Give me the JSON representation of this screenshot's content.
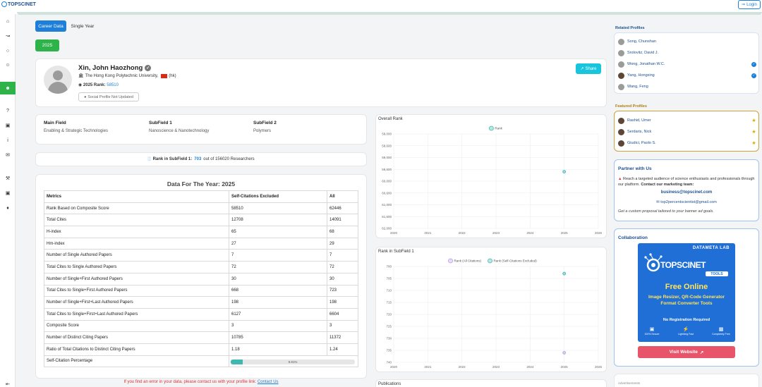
{
  "app": {
    "logo_text": "TOPSCINET",
    "login_label": "Login"
  },
  "sidebar": {
    "icons": [
      "home-icon",
      "chart-icon",
      "award-icon",
      "user-check-icon",
      "users-icon",
      "question-icon",
      "inbox-icon",
      "info-icon",
      "mail-icon",
      "wrench-icon",
      "briefcase-icon",
      "tags-icon",
      "collapse-icon"
    ]
  },
  "tabs": {
    "career": "Career Data",
    "single": "Single Year"
  },
  "year_button": "2025",
  "profile": {
    "name": "Xin, John Haozhong",
    "university": "The Hong Kong Polytechnic University,",
    "country_code": "(hk)",
    "rank_label": "2025 Rank:",
    "rank_value": "58510",
    "social_label": "Social Profile Not Updated",
    "share_label": "Share"
  },
  "fields": {
    "main_label": "Main Field",
    "main_value": "Enabling & Strategic Technologies",
    "sub1_label": "SubField 1",
    "sub1_value": "Nanoscience & Nanotechnology",
    "sub2_label": "SubField 2",
    "sub2_value": "Polymers"
  },
  "subfield_rank": {
    "prefix": "Rank in SubField 1:",
    "value": "703",
    "suffix": "out of 156020 Researchers"
  },
  "data_table": {
    "title": "Data For The Year: 2025",
    "headers": [
      "Metrics",
      "Self-Citations Excluded",
      "All"
    ],
    "rows": [
      [
        "Rank Based on Composite Score",
        "58510",
        "62446"
      ],
      [
        "Total Cites",
        "12708",
        "14091"
      ],
      [
        "H-index",
        "65",
        "68"
      ],
      [
        "Hm-index",
        "27",
        "29"
      ],
      [
        "Number of Single Authored Papers",
        "7",
        "7"
      ],
      [
        "Total Cites to Single Authored Papers",
        "72",
        "72"
      ],
      [
        "Number of Single+First Authored Papers",
        "30",
        "30"
      ],
      [
        "Total Cites to Single+First Authored Papers",
        "668",
        "723"
      ],
      [
        "Number of Single+First+Last Authored Papers",
        "198",
        "198"
      ],
      [
        "Total Cites to Single+First+Last Authored Papers",
        "6127",
        "6604"
      ],
      [
        "Composite Score",
        "3",
        "3"
      ],
      [
        "Number of Distinct Citing Papers",
        "10785",
        "11372"
      ],
      [
        "Ratio of Total Citations to Distinct Citing Papers",
        "1.18",
        "1.24"
      ]
    ],
    "self_citation_label": "Self-Citation Percentage",
    "self_citation_text": "9.81%",
    "self_citation_fraction": 0.0981
  },
  "error_notice": {
    "text": "If you find an error in your data, please contact us with your profile link:",
    "link": "Contact Us"
  },
  "chart_data": [
    {
      "type": "scatter",
      "title": "Overall Rank",
      "legend": [
        "Rank"
      ],
      "legend_placement": "top",
      "x_ticks": [
        "2020",
        "2021",
        "2022",
        "2023",
        "2024",
        "2025",
        "2026"
      ],
      "y_ticks": [
        "58,000",
        "58,600",
        "59,000",
        "59,600",
        "60,000",
        "60,600",
        "61,000",
        "61,600",
        "62,000"
      ],
      "xlim": [
        2020,
        2026
      ],
      "ylim": [
        58000,
        62000
      ],
      "y_inverted": true,
      "grid": true,
      "series": [
        {
          "name": "Rank",
          "color": "#3fb8b1",
          "points": [
            [
              2025,
              59600
            ]
          ]
        }
      ]
    },
    {
      "type": "scatter",
      "title": "Rank in SubField 1",
      "legend": [
        "Rank (All Citations)",
        "Rank (Self-Citations Excluded)"
      ],
      "legend_placement": "top",
      "x_ticks": [
        "2020",
        "2021",
        "2022",
        "2023",
        "2024",
        "2025",
        "2026"
      ],
      "y_ticks": [
        "700",
        "705",
        "710",
        "715",
        "720",
        "725",
        "730",
        "735",
        "740"
      ],
      "xlim": [
        2020,
        2026
      ],
      "ylim": [
        700,
        740
      ],
      "y_inverted": true,
      "grid": true,
      "series": [
        {
          "name": "Rank (All Citations)",
          "color": "#b69ce8",
          "points": [
            [
              2025,
              736
            ]
          ]
        },
        {
          "name": "Rank (Self-Citations Excluded)",
          "color": "#3fb8b1",
          "points": [
            [
              2025,
              703
            ]
          ]
        }
      ]
    }
  ],
  "publications_label": "Publications",
  "related": {
    "title": "Related Profiles",
    "items": [
      {
        "name": "Song, Chunshan",
        "verified": false,
        "photo": false
      },
      {
        "name": "Srolovitz, David J.",
        "verified": false,
        "photo": false
      },
      {
        "name": "Wong, Jonathan W.C.",
        "verified": true,
        "photo": false
      },
      {
        "name": "Yang, Hongxing",
        "verified": true,
        "photo": true
      },
      {
        "name": "Wang, Feng",
        "verified": false,
        "photo": false
      }
    ]
  },
  "featured": {
    "title": "Featured Profiles",
    "items": [
      {
        "name": "Rashid, Umer"
      },
      {
        "name": "Serdaris, Nick"
      },
      {
        "name": "Giudici, Paolo S."
      }
    ]
  },
  "partner": {
    "title": "Partner with Us",
    "text_lead": "Reach a targeted audience of science enthusiasts and professionals through our platform.",
    "text_bold": "Contact our marketing team:",
    "email_primary": "business@topscinet.com",
    "email_secondary": "top2percentscientist@gmail.com",
    "note": "Get a custom proposal tailored to your banner ad goals."
  },
  "collaboration": {
    "title": "Collaboration",
    "ad_lab": "DATAMETA LAB",
    "ad_brand": "TOPSCINET",
    "ad_tools": "TOOLS",
    "ad_free": "Free Online",
    "ad_desc": "Image Resizer, QR-Code Generator Format Converter Tools",
    "ad_noreg": "No Registration Required",
    "ad_feat1": "100% Secure",
    "ad_feat2": "Lightning Fast",
    "ad_feat3": "Completely Free",
    "visit_label": "Visit Website"
  },
  "ads_label": "Advertisements"
}
